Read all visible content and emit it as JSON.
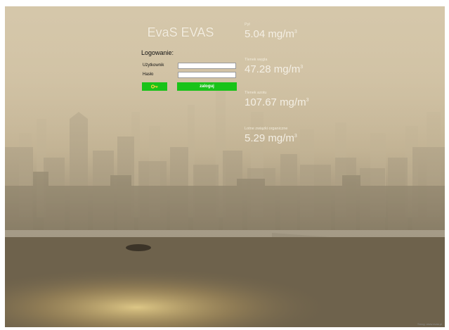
{
  "app": {
    "title": "EvaS EVAS"
  },
  "login": {
    "heading": "Logowanie:",
    "user_label": "Użytkownik",
    "user_value": "",
    "password_label": "Hasło",
    "password_value": "",
    "key_icon": "key-icon",
    "submit_label": "zaloguj"
  },
  "metrics": [
    {
      "label": "Pył",
      "value": "5.04",
      "unit": "mg/m",
      "exp": "3"
    },
    {
      "label": "Tlenek węgla",
      "value": "47.28",
      "unit": "mg/m",
      "exp": "3"
    },
    {
      "label": "Tlenek azotu",
      "value": "107.67",
      "unit": "mg/m",
      "exp": "3"
    },
    {
      "label": "Lotne związki organiczne",
      "value": "5.29",
      "unit": "mg/m",
      "exp": "3"
    }
  ],
  "footer": {
    "note": "Smog. www.evas.pl"
  },
  "colors": {
    "accent_green": "#19c319",
    "haze": "#cfc1a4",
    "water": "#8a7f68"
  }
}
